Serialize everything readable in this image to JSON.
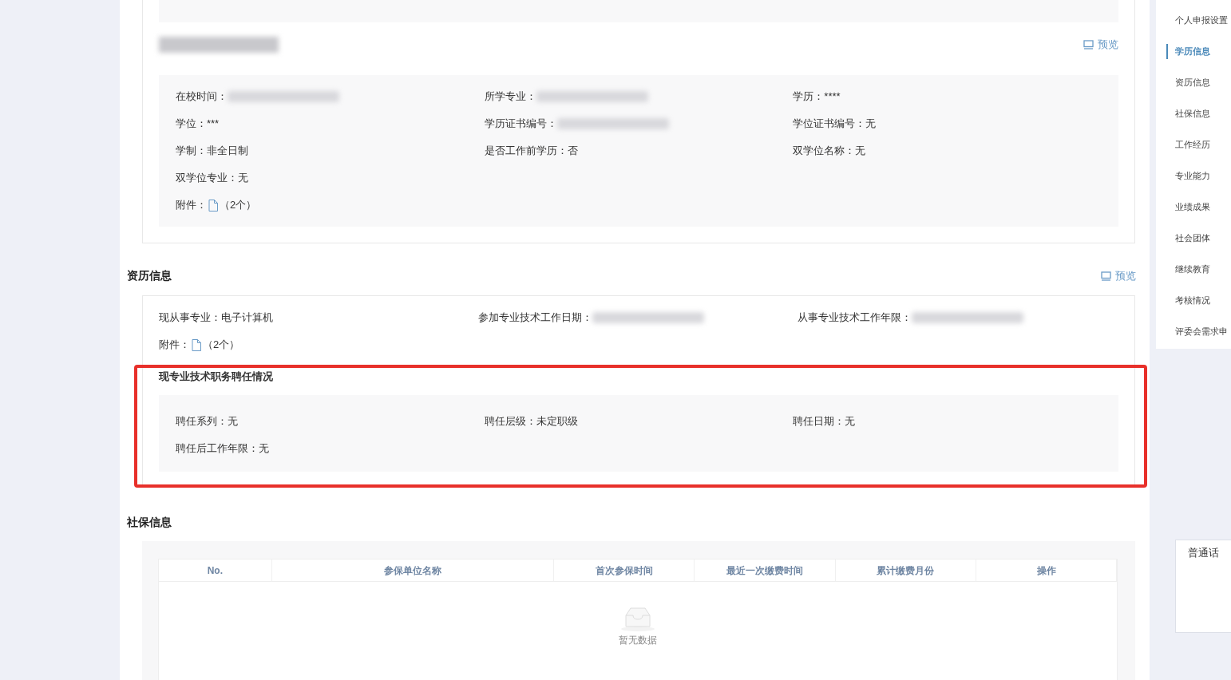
{
  "education": {
    "preview": "预览",
    "title_redacted": true,
    "fields": [
      {
        "label": "在校时间：",
        "redacted": true
      },
      {
        "label": "所学专业：",
        "redacted": true
      },
      {
        "label": "学历：",
        "value": "****"
      },
      {
        "label": "学位：",
        "value": "***"
      },
      {
        "label": "学历证书编号：",
        "redacted": true
      },
      {
        "label": "学位证书编号：",
        "value": "无"
      },
      {
        "label": "学制：",
        "value": "非全日制"
      },
      {
        "label": "是否工作前学历：",
        "value": "否"
      },
      {
        "label": "双学位名称：",
        "value": "无"
      },
      {
        "label": "双学位专业：",
        "value": "无"
      }
    ],
    "attachment": {
      "label": "附件：",
      "count": "（2个）"
    }
  },
  "qualification": {
    "title": "资历信息",
    "preview": "预览",
    "fields": [
      {
        "label": "现从事专业：",
        "value": "电子计算机"
      },
      {
        "label": "参加专业技术工作日期：",
        "redacted": true
      },
      {
        "label": "从事专业技术工作年限：",
        "redacted": true
      }
    ],
    "attachment": {
      "label": "附件：",
      "count": "（2个）"
    },
    "appointment": {
      "title": "现专业技术职务聘任情况",
      "highlighted": true,
      "fields": [
        {
          "label": "聘任系列：",
          "value": "无"
        },
        {
          "label": "聘任层级：",
          "value": "未定职级"
        },
        {
          "label": "聘任日期：",
          "value": "无"
        },
        {
          "label": "聘任后工作年限：",
          "value": "无"
        }
      ]
    }
  },
  "social_security": {
    "title": "社保信息",
    "table": {
      "columns": [
        "No.",
        "参保单位名称",
        "首次参保时间",
        "最近一次缴费时间",
        "累计缴费月份",
        "操作"
      ],
      "empty_text": "暂无数据"
    }
  },
  "sidebar": {
    "items": [
      {
        "label": "个人申报设置",
        "selected": false
      },
      {
        "label": "学历信息",
        "selected": true
      },
      {
        "label": "资历信息",
        "selected": false
      },
      {
        "label": "社保信息",
        "selected": false
      },
      {
        "label": "工作经历",
        "selected": false
      },
      {
        "label": "专业能力",
        "selected": false
      },
      {
        "label": "业绩成果",
        "selected": false
      },
      {
        "label": "社会团体",
        "selected": false
      },
      {
        "label": "继续教育",
        "selected": false
      },
      {
        "label": "考核情况",
        "selected": false
      },
      {
        "label": "评委会需求申",
        "selected": false
      }
    ]
  },
  "language_widget": {
    "label": "普通话"
  }
}
